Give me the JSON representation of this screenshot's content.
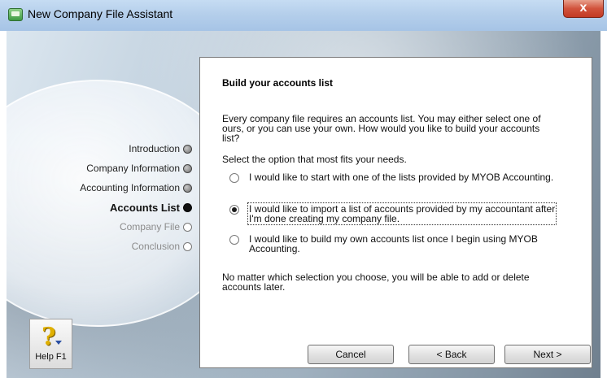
{
  "window": {
    "title": "New Company File Assistant",
    "close_label": "x"
  },
  "steps": [
    {
      "label": "Introduction",
      "state": "done"
    },
    {
      "label": "Company Information",
      "state": "done"
    },
    {
      "label": "Accounting Information",
      "state": "done"
    },
    {
      "label": "Accounts List",
      "state": "active"
    },
    {
      "label": "Company File",
      "state": "pending"
    },
    {
      "label": "Conclusion",
      "state": "pending"
    }
  ],
  "panel": {
    "heading": "Build your accounts list",
    "intro_1": "Every company file requires an accounts list.  You may either select one of",
    "intro_2": "ours, or you can use your own.  How would you like to build your accounts",
    "intro_3": "list?",
    "prompt": "Select the option that most fits your needs.",
    "options": [
      {
        "line1": "I would like to start with one of the lists provided by MYOB Accounting.",
        "line2": "",
        "selected": false
      },
      {
        "line1": "I would like to import a list of accounts provided by my accountant after",
        "line2": "I'm done creating my company file.",
        "selected": true
      },
      {
        "line1": "I would like to build my own accounts list once I begin using MYOB",
        "line2": "Accounting.",
        "selected": false
      }
    ],
    "note_1": "No matter which selection you choose, you will be able to add or delete",
    "note_2": "accounts later."
  },
  "buttons": {
    "help": "Help F1",
    "cancel": "Cancel",
    "back": "< Back",
    "next": "Next >"
  },
  "icons": {
    "help": "help-question-icon",
    "close": "close-icon",
    "app": "myob-app-icon"
  }
}
